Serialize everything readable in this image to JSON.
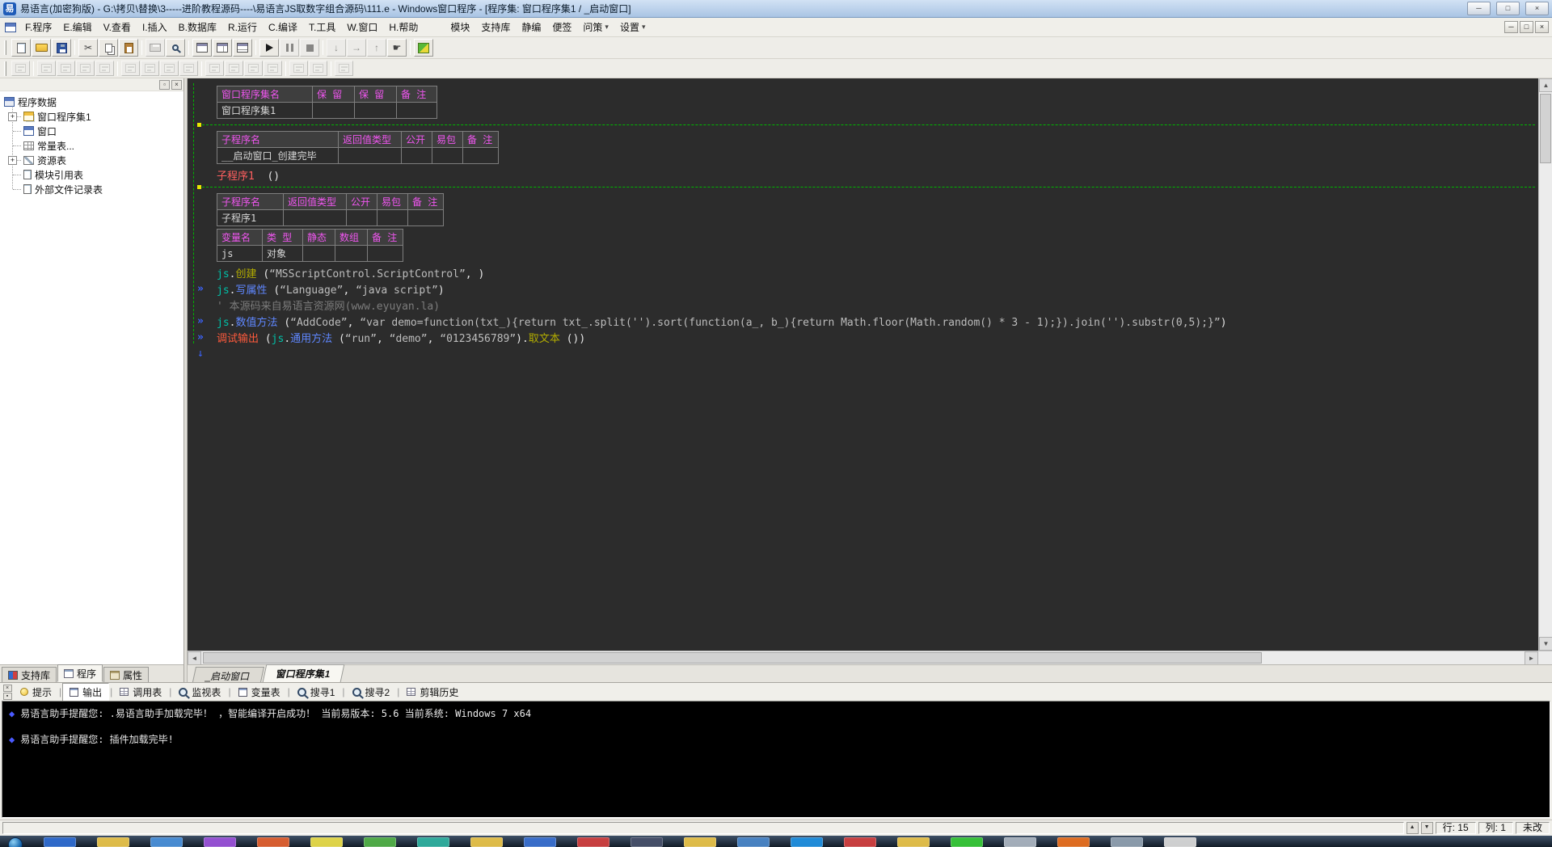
{
  "glyphs": {
    "min": "─",
    "max": "□",
    "close": "×",
    "restore": "□",
    "up": "▲",
    "down": "▼",
    "left": "◄",
    "right": "►",
    "float": "▫",
    "pin": "▪",
    "dropdown": "▾",
    "marker": "»",
    "down_arrow": "↓",
    "diamond": "◆",
    "sep": "|",
    "cut": "✂",
    "hand": "☛",
    "arr_down": "↓",
    "arr_right": "→",
    "arr_up": "↑"
  },
  "titlebar": {
    "icon_label": "易",
    "title": "易语言(加密狗版) - G:\\拷贝\\替换\\3-----进阶教程源码----\\易语言JS取数字组合源码\\111.e - Windows窗口程序 - [程序集: 窗口程序集1 / _启动窗口]"
  },
  "menubar": {
    "items": [
      {
        "id": "program",
        "label": "F.程序"
      },
      {
        "id": "edit",
        "label": "E.编辑"
      },
      {
        "id": "view",
        "label": "V.查看"
      },
      {
        "id": "insert",
        "label": "I.插入"
      },
      {
        "id": "database",
        "label": "B.数据库"
      },
      {
        "id": "run",
        "label": "R.运行"
      },
      {
        "id": "compile",
        "label": "C.编译"
      },
      {
        "id": "tools",
        "label": "T.工具"
      },
      {
        "id": "window",
        "label": "W.窗口"
      },
      {
        "id": "help",
        "label": "H.帮助"
      }
    ],
    "plugin_items": [
      {
        "id": "module",
        "label": "模块",
        "arrow": false
      },
      {
        "id": "support-lib",
        "label": "支持库",
        "arrow": false
      },
      {
        "id": "static-compile",
        "label": "静编",
        "arrow": false
      },
      {
        "id": "notes",
        "label": "便签",
        "arrow": false
      },
      {
        "id": "ask",
        "label": "问策",
        "arrow": true
      },
      {
        "id": "settings",
        "label": "设置",
        "arrow": true
      }
    ]
  },
  "toolbar_main": [
    {
      "id": "new-file",
      "icon": "new"
    },
    {
      "id": "open-file",
      "icon": "open"
    },
    {
      "id": "save-file",
      "icon": "save"
    },
    {
      "sep": true
    },
    {
      "id": "cut",
      "icon": "cut"
    },
    {
      "id": "copy",
      "icon": "copy"
    },
    {
      "id": "paste",
      "icon": "paste"
    },
    {
      "sep": true
    },
    {
      "id": "print",
      "icon": "print",
      "disabled": true
    },
    {
      "id": "find",
      "icon": "mag"
    },
    {
      "sep": true
    },
    {
      "id": "layout-workspace",
      "icon": "win1"
    },
    {
      "id": "layout-split",
      "icon": "win2"
    },
    {
      "id": "layout-output",
      "icon": "win3"
    },
    {
      "sep": true
    },
    {
      "id": "run",
      "icon": "run"
    },
    {
      "id": "pause",
      "icon": "pause",
      "disabled": true
    },
    {
      "id": "stop",
      "icon": "stop",
      "disabled": true
    },
    {
      "sep": true
    },
    {
      "id": "step-into",
      "icon": "arr_down",
      "disabled": true
    },
    {
      "id": "step-over",
      "icon": "arr_right",
      "disabled": true
    },
    {
      "id": "step-out",
      "icon": "arr_up",
      "disabled": true
    },
    {
      "id": "toggle-breakpoint",
      "icon": "hand"
    },
    {
      "sep": true
    },
    {
      "id": "plugin-tool",
      "icon": "special"
    }
  ],
  "toolbar_secondary": {
    "groups": [
      1,
      4,
      4,
      4,
      2,
      1
    ]
  },
  "sidebar": {
    "tree": {
      "root": {
        "id": "program-data",
        "label": "程序数据",
        "icon": "data"
      },
      "items": [
        {
          "id": "window-assembly-1",
          "label": "窗口程序集1",
          "icon": "asm",
          "expander": "+"
        },
        {
          "id": "window",
          "label": "窗口",
          "icon": "winform",
          "expander": ""
        },
        {
          "id": "constant-table",
          "label": "常量表...",
          "icon": "consts",
          "expander": ""
        },
        {
          "id": "resource-table",
          "label": "资源表",
          "icon": "res",
          "expander": "+"
        },
        {
          "id": "module-ref-table",
          "label": "模块引用表",
          "icon": "mod",
          "expander": ""
        },
        {
          "id": "external-file-table",
          "label": "外部文件记录表",
          "icon": "extfile",
          "expander": ""
        }
      ]
    },
    "tabs": [
      {
        "id": "support-lib",
        "label": "支持库",
        "icon": "book",
        "active": false
      },
      {
        "id": "program",
        "label": "程序",
        "icon": "sheet2",
        "active": true
      },
      {
        "id": "properties",
        "label": "属性",
        "icon": "prop",
        "active": false
      }
    ]
  },
  "editor": {
    "blocks": [
      {
        "type": "table",
        "name": "assembly-table",
        "widths": [
          118,
          52,
          52,
          50
        ],
        "headers": [
          "窗口程序集名",
          "保 留",
          "保 留",
          "备 注"
        ],
        "rows": [
          [
            {
              "t": "窗口程序集1",
              "c": "magenta"
            },
            {
              "t": ""
            },
            {
              "t": ""
            },
            {
              "t": ""
            }
          ]
        ]
      },
      {
        "type": "dashes"
      },
      {
        "type": "table",
        "name": "sub-table-startup",
        "widths": [
          150,
          78,
          38,
          38,
          44
        ],
        "headers": [
          "子程序名",
          "返回值类型",
          "公开",
          "易包",
          "备 注"
        ],
        "rows": [
          [
            {
              "t": "__启动窗口_创建完毕",
              "c": "red"
            },
            {
              "t": ""
            },
            {
              "t": ""
            },
            {
              "t": ""
            },
            {
              "t": ""
            }
          ]
        ]
      },
      {
        "type": "code",
        "lines": [
          {
            "marker": false,
            "tokens": [
              {
                "t": "子程序1",
                "c": "red"
              },
              {
                "t": "  ()",
                "c": "plain"
              }
            ]
          }
        ]
      },
      {
        "type": "dashes"
      },
      {
        "type": "table",
        "name": "sub-table-sub1",
        "widths": [
          82,
          78,
          38,
          38,
          44
        ],
        "headers": [
          "子程序名",
          "返回值类型",
          "公开",
          "易包",
          "备 注"
        ],
        "rows": [
          [
            {
              "t": "子程序1",
              "c": "red"
            },
            {
              "t": ""
            },
            {
              "t": ""
            },
            {
              "t": ""
            },
            {
              "t": ""
            }
          ]
        ]
      },
      {
        "type": "table",
        "name": "local-var-table",
        "widths": [
          56,
          50,
          40,
          40,
          44
        ],
        "headers": [
          "变量名",
          "类 型",
          "静态",
          "数组",
          "备 注"
        ],
        "rows": [
          [
            {
              "t": "js",
              "c": "obj"
            },
            {
              "t": "对象",
              "c": "magenta"
            },
            {
              "t": ""
            },
            {
              "t": ""
            },
            {
              "t": ""
            }
          ]
        ]
      },
      {
        "type": "code",
        "lines": [
          {
            "marker": false,
            "tokens": [
              {
                "t": "js",
                "c": "obj"
              },
              {
                "t": ".",
                "c": "plain"
              },
              {
                "t": "创建",
                "c": "myel"
              },
              {
                "t": " (",
                "c": "plain"
              },
              {
                "t": "“MSScriptControl.ScriptControl”",
                "c": "str"
              },
              {
                "t": ", )",
                "c": "plain"
              }
            ]
          },
          {
            "marker": true,
            "tokens": [
              {
                "t": "js",
                "c": "obj"
              },
              {
                "t": ".",
                "c": "plain"
              },
              {
                "t": "写属性",
                "c": "mblu"
              },
              {
                "t": " (",
                "c": "plain"
              },
              {
                "t": "“Language”",
                "c": "str"
              },
              {
                "t": ", ",
                "c": "plain"
              },
              {
                "t": "“java script”",
                "c": "str"
              },
              {
                "t": ")",
                "c": "plain"
              }
            ]
          },
          {
            "marker": false,
            "tokens": [
              {
                "t": "' 本源码来自易语言资源网(www.eyuyan.la)",
                "c": "com"
              }
            ]
          },
          {
            "marker": true,
            "tokens": [
              {
                "t": "js",
                "c": "obj"
              },
              {
                "t": ".",
                "c": "plain"
              },
              {
                "t": "数值方法",
                "c": "mblu"
              },
              {
                "t": " (",
                "c": "plain"
              },
              {
                "t": "“AddCode”",
                "c": "str"
              },
              {
                "t": ", ",
                "c": "plain"
              },
              {
                "t": "“var demo=function(txt_){return txt_.split('').sort(function(a_, b_){return Math.floor(Math.random() * 3 - 1);}).join('').substr(0,5);}”",
                "c": "str"
              },
              {
                "t": ")",
                "c": "plain"
              }
            ]
          },
          {
            "marker": true,
            "tokens": [
              {
                "t": "调试输出",
                "c": "cmd"
              },
              {
                "t": " (",
                "c": "plain"
              },
              {
                "t": "js",
                "c": "obj"
              },
              {
                "t": ".",
                "c": "plain"
              },
              {
                "t": "通用方法",
                "c": "mblu"
              },
              {
                "t": " (",
                "c": "plain"
              },
              {
                "t": "“run”",
                "c": "str"
              },
              {
                "t": ", ",
                "c": "plain"
              },
              {
                "t": "“demo”",
                "c": "str"
              },
              {
                "t": ", ",
                "c": "plain"
              },
              {
                "t": "“0123456789”",
                "c": "str"
              },
              {
                "t": ")",
                "c": "plain"
              },
              {
                "t": ".",
                "c": "plain"
              },
              {
                "t": "取文本",
                "c": "myel"
              },
              {
                "t": " ())",
                "c": "plain"
              }
            ]
          }
        ]
      },
      {
        "type": "arrow"
      }
    ]
  },
  "doc_tabs": [
    {
      "id": "startup-window",
      "label": "_启动窗口",
      "active": false
    },
    {
      "id": "window-assembly-1",
      "label": "窗口程序集1",
      "active": true
    }
  ],
  "dock": {
    "tabs": [
      {
        "id": "hints",
        "label": "提示",
        "icon": "bulb",
        "active": false
      },
      {
        "id": "output",
        "label": "输出",
        "icon": "sheet",
        "active": true
      },
      {
        "id": "call-table",
        "label": "调用表",
        "icon": "grid",
        "active": false
      },
      {
        "id": "watch-table",
        "label": "监视表",
        "icon": "mag",
        "active": false
      },
      {
        "id": "variable-table",
        "label": "变量表",
        "icon": "sheet",
        "active": false
      },
      {
        "id": "search1",
        "label": "搜寻1",
        "icon": "mag",
        "active": false
      },
      {
        "id": "search2",
        "label": "搜寻2",
        "icon": "mag",
        "active": false
      },
      {
        "id": "clip-history",
        "label": "剪辑历史",
        "icon": "grid",
        "active": false
      }
    ],
    "output_lines": [
      {
        "text": "易语言助手提醒您: .易语言助手加载完毕！ ，智能编译开启成功！  当前易版本: 5.6  当前系统: Windows 7 x64"
      },
      {
        "text": "易语言助手提醒您: 插件加载完毕!"
      }
    ]
  },
  "statusbar": {
    "row": "行: 15",
    "col": "列: 1",
    "state": "未改"
  },
  "taskbar": {
    "icons": [
      "#2f6cd0",
      "#e8c34a",
      "#4a90d9",
      "#9a52d9",
      "#e06030",
      "#e8dc4a",
      "#52b048",
      "#30b0a0",
      "#e8c34a",
      "#3a70d0",
      "#d04040",
      "#47506a",
      "#e8c34a",
      "#4a86c8",
      "#2090e0",
      "#d04040",
      "#e8c34a",
      "#38c838",
      "#aab4c0",
      "#e87020",
      "#90a0b0",
      "#d8d8d8"
    ]
  }
}
